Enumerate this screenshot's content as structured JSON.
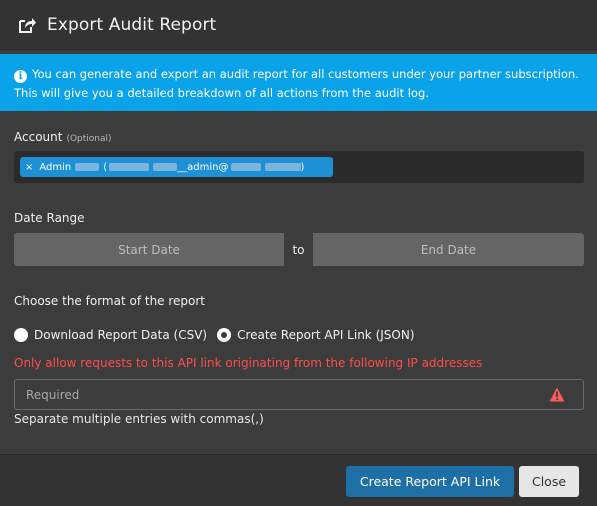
{
  "dialog": {
    "title": "Export Audit Report",
    "title_icon": "share-export-icon"
  },
  "info": {
    "icon": "info-icon",
    "text": "You can generate and export an audit report for all customers under your partner subscription. This will give you a detailed breakdown of all actions from the audit log."
  },
  "account": {
    "label": "Account",
    "optional": "(Optional)",
    "chip": {
      "prefix": "Admin",
      "middle": "__admin@"
    }
  },
  "date_range": {
    "label": "Date Range",
    "start_placeholder": "Start Date",
    "separator": "to",
    "end_placeholder": "End Date"
  },
  "format": {
    "label": "Choose the format of the report",
    "options": [
      {
        "label": "Download Report Data (CSV)",
        "checked": false
      },
      {
        "label": "Create Report API Link (JSON)",
        "checked": true
      }
    ]
  },
  "ip": {
    "warning": "Only allow requests to this API link originating from the following IP addresses",
    "placeholder": "Required",
    "value": "",
    "help": "Separate multiple entries with commas(,)",
    "alert_icon": "warning-triangle-icon"
  },
  "footer": {
    "primary_label": "Create Report API Link",
    "close_label": "Close"
  },
  "colors": {
    "background": "#3c3c3c",
    "header": "#333333",
    "info_banner": "#0aa2e8",
    "chip": "#1e90d6",
    "primary_button": "#1d6fa5",
    "error": "#ff4d4d"
  }
}
